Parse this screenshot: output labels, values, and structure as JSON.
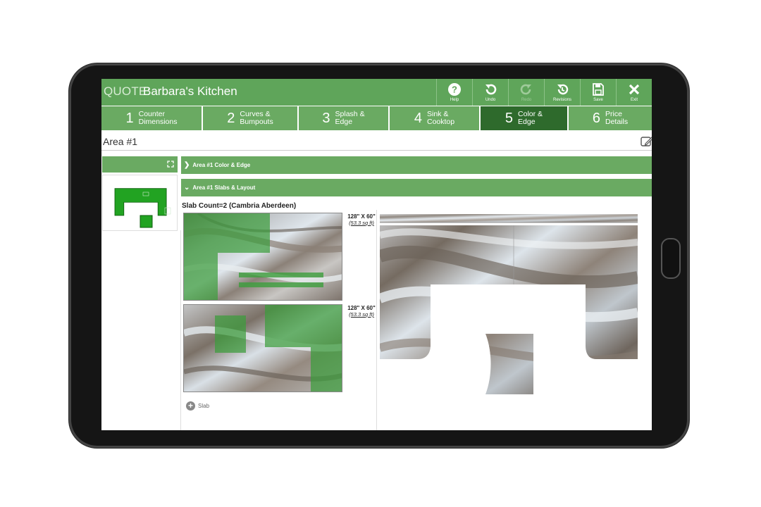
{
  "header": {
    "quote_label": "QUOTE:",
    "title": "Barbara's Kitchen",
    "tools": [
      {
        "label": "Help",
        "icon": "help-icon",
        "enabled": true
      },
      {
        "label": "Undo",
        "icon": "undo-icon",
        "enabled": true
      },
      {
        "label": "Redo",
        "icon": "redo-icon",
        "enabled": false
      },
      {
        "label": "Revisions",
        "icon": "revisions-icon",
        "enabled": true
      },
      {
        "label": "Save",
        "icon": "save-icon",
        "enabled": true
      },
      {
        "label": "Exit",
        "icon": "close-icon",
        "enabled": true
      }
    ]
  },
  "steps": [
    {
      "num": "1",
      "line1": "Counter",
      "line2": "Dimensions",
      "active": false
    },
    {
      "num": "2",
      "line1": "Curves &",
      "line2": "Bumpouts",
      "active": false
    },
    {
      "num": "3",
      "line1": "Splash &",
      "line2": "Edge",
      "active": false
    },
    {
      "num": "4",
      "line1": "Sink &",
      "line2": "Cooktop",
      "active": false
    },
    {
      "num": "5",
      "line1": "Color &",
      "line2": "Edge",
      "active": true
    },
    {
      "num": "6",
      "line1": "Price",
      "line2": "Details",
      "active": false
    }
  ],
  "area": {
    "title": "Area #1"
  },
  "sections": {
    "color_edge": "Area #1 Color & Edge",
    "slabs_layout": "Area #1 Slabs & Layout"
  },
  "slabs": {
    "count_label": "Slab Count=2 (Cambria Aberdeen)",
    "items": [
      {
        "dims": "128\" X 60\"",
        "area": "(53.3 sq ft)"
      },
      {
        "dims": "128\" X 60\"",
        "area": "(53.3 sq ft)"
      }
    ],
    "add_label": "Slab"
  },
  "colors": {
    "header_green": "#5fa55a",
    "active_step": "#2e6a2c",
    "step_green": "#6aaa62",
    "overlay_green": "#3a9a3a"
  }
}
